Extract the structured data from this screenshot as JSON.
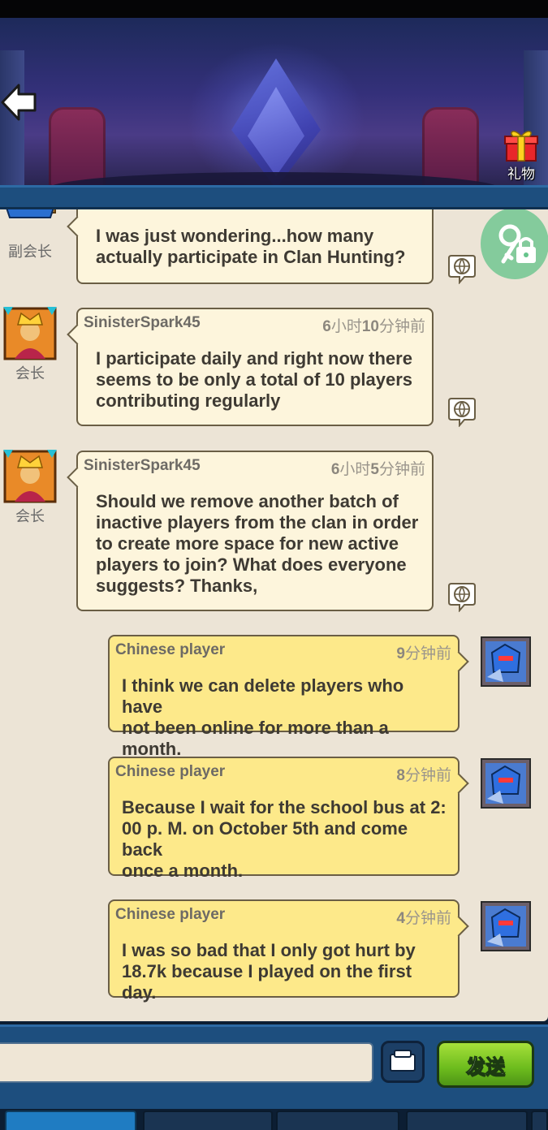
{
  "header": {
    "back_icon": "back-arrow-icon",
    "gift_label": "礼物",
    "gift_icon": "gift-box-icon"
  },
  "messages": [
    {
      "side": "left",
      "rank": "副会长",
      "rank_badge": "2",
      "text_lines": [
        "I was just wondering...how many",
        "actually participate in Clan Hunting?"
      ]
    },
    {
      "side": "left",
      "name": "SinisterSpark45",
      "time_prefix": "6",
      "time_mid": "小时",
      "time_num2": "10",
      "time_suffix": "分钟前",
      "rank": "会长",
      "text_lines": [
        "I participate daily and right now there",
        "seems to be only a total of 10 players",
        "contributing regularly"
      ]
    },
    {
      "side": "left",
      "name": "SinisterSpark45",
      "time_prefix": "6",
      "time_mid": "小时",
      "time_num2": "5",
      "time_suffix": "分钟前",
      "rank": "会长",
      "text_lines": [
        "Should we remove another batch of",
        "inactive players from the clan in order",
        "to create more space for new active",
        "players to join? What does everyone",
        "suggests? Thanks,"
      ]
    },
    {
      "side": "right",
      "name": "Chinese player",
      "time_num": "9",
      "time_suffix": "分钟前",
      "text_lines": [
        "I think we can delete players who have",
        "not been online for more than a month."
      ]
    },
    {
      "side": "right",
      "name": "Chinese player",
      "time_num": "8",
      "time_suffix": "分钟前",
      "text_lines": [
        "Because I wait for the school bus at 2:",
        "00 p. M. on October 5th and come back",
        "once a month."
      ]
    },
    {
      "side": "right",
      "name": "Chinese player",
      "time_num": "4",
      "time_suffix": "分钟前",
      "text_lines": [
        "I was so bad that I only got hurt by",
        "18.7k because I played on the first day."
      ]
    }
  ],
  "input": {
    "value": "",
    "send_label": "发送"
  },
  "colors": {
    "chat_bg": "#ece4d6",
    "bubble_left": "#fdf5dc",
    "bubble_right": "#fde98a",
    "bar_blue": "#1d4e7e",
    "send_green": "#6cbb1d"
  }
}
